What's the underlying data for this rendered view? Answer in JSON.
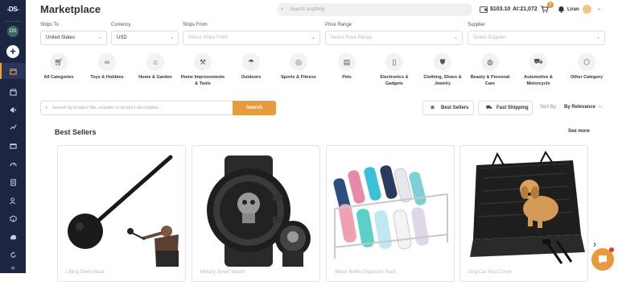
{
  "app": {
    "logo": "-DS-",
    "title": "Marketplace"
  },
  "topbar": {
    "search_placeholder": "Search anything",
    "wallet_balance": "$103.10",
    "points": "AI:21,072",
    "cart_count": "2",
    "user_name": "Liran"
  },
  "sidebar": {
    "avatar_initials": "DS",
    "items": [
      {
        "icon": "plus-icon"
      },
      {
        "icon": "calendar-icon",
        "active": true
      },
      {
        "icon": "store-icon"
      },
      {
        "icon": "megaphone-icon"
      },
      {
        "icon": "chart-icon"
      },
      {
        "icon": "gift-icon"
      },
      {
        "icon": "gauge-icon"
      },
      {
        "icon": "document-icon"
      },
      {
        "icon": "users-icon"
      },
      {
        "icon": "box-icon"
      },
      {
        "icon": "upload-icon"
      },
      {
        "icon": "refresh-icon"
      },
      {
        "icon": "expand-icon"
      }
    ]
  },
  "filters": {
    "ships_to": {
      "label": "Ships To",
      "value": "United States"
    },
    "currency": {
      "label": "Currency",
      "value": "USD"
    },
    "ships_from": {
      "label": "Ships From",
      "placeholder": "Select Ships From"
    },
    "price_range": {
      "label": "Price Range",
      "placeholder": "Select Price Range"
    },
    "supplier": {
      "label": "Supplier",
      "placeholder": "Select Supplier"
    }
  },
  "categories": [
    {
      "label": "All Categories",
      "icon": "cart-icon"
    },
    {
      "label": "Toys & Hobbies",
      "icon": "binoculars-icon"
    },
    {
      "label": "Home & Garden",
      "icon": "house-icon"
    },
    {
      "label": "Home Improvements & Tools",
      "icon": "tools-icon"
    },
    {
      "label": "Outdoors",
      "icon": "umbrella-icon"
    },
    {
      "label": "Sports & Fitness",
      "icon": "ball-icon"
    },
    {
      "label": "Pets",
      "icon": "pet-icon"
    },
    {
      "label": "Electronics & Gadgets",
      "icon": "phone-icon"
    },
    {
      "label": "Clothing, Shoes & Jewelry",
      "icon": "shirt-icon"
    },
    {
      "label": "Beauty & Personal Care",
      "icon": "beauty-icon"
    },
    {
      "label": "Automotive & Motorcycle",
      "icon": "car-icon"
    },
    {
      "label": "Other Category",
      "icon": "cube-icon"
    }
  ],
  "product_search": {
    "placeholder": "Search by product title, supplier or product description...",
    "button": "Search"
  },
  "toolbar": {
    "best_sellers": "Best Sellers",
    "fast_shipping": "Fast Shipping",
    "sort_label": "Sort By:",
    "sort_value": "By Relevance"
  },
  "section": {
    "title": "Best Sellers",
    "see_more": "See more"
  },
  "products": [
    {
      "title": "Lifting Steel Mace",
      "image": "steel-mace"
    },
    {
      "title": "Military Smart Watch",
      "image": "smart-watch"
    },
    {
      "title": "Water Bottle Organizer Rack",
      "image": "water-bottles"
    },
    {
      "title": "Dog Car Seat Cover",
      "image": "dog-seat-cover"
    }
  ],
  "colors": {
    "sidebar": "#1c2541",
    "accent": "#e89a3c"
  }
}
